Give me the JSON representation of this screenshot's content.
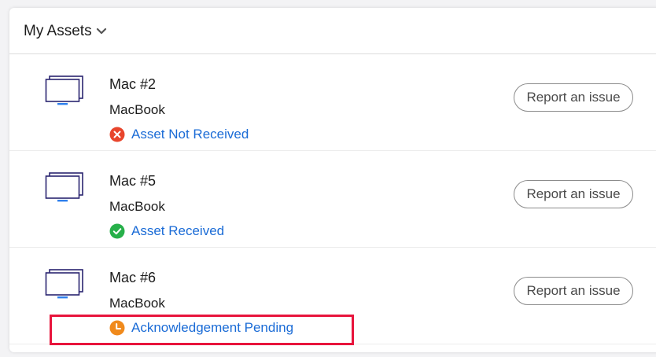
{
  "header": {
    "title": "My Assets"
  },
  "assets": [
    {
      "name": "Mac #2",
      "type": "MacBook",
      "status": "Asset Not Received",
      "status_icon": "error-x-icon",
      "status_color": "#e8452c",
      "action_label": "Report an issue"
    },
    {
      "name": "Mac #5",
      "type": "MacBook",
      "status": "Asset Received",
      "status_icon": "checkmark-icon",
      "status_color": "#27b04a",
      "action_label": "Report an issue"
    },
    {
      "name": "Mac #6",
      "type": "MacBook",
      "status": "Acknowledgement Pending",
      "status_icon": "clock-icon",
      "status_color": "#f08a1c",
      "action_label": "Report an issue",
      "highlighted": true
    }
  ],
  "colors": {
    "link": "#1a6bd6",
    "highlight_border": "#e8143c",
    "device_icon": "#2a2470",
    "device_icon_base": "#2f80ed"
  }
}
